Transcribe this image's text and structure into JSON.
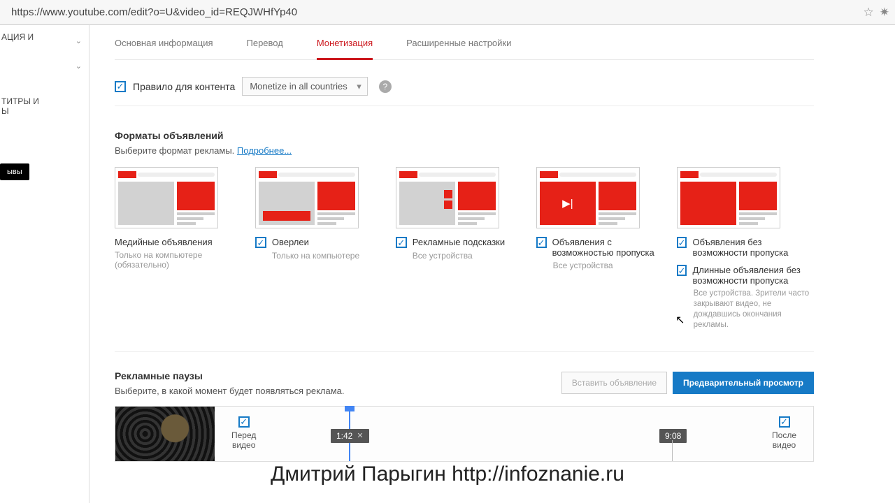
{
  "address_bar": {
    "url": "https://www.youtube.com/edit?o=U&video_id=REQJWHfYp40"
  },
  "sidebar": {
    "sec1": "АЦИЯ И",
    "sec2": "ТИТРЫ И\nЫ",
    "reviews_btn": "ывы"
  },
  "tabs": {
    "basic": "Основная информация",
    "translate": "Перевод",
    "monetize": "Монетизация",
    "advanced": "Расширенные настройки"
  },
  "policy": {
    "checkbox_label": "Правило для контента",
    "dropdown_value": "Monetize in all countries"
  },
  "formats": {
    "heading": "Форматы объявлений",
    "subtext": "Выберите формат рекламы. ",
    "more": "Подробнее...",
    "f1": {
      "title": "Медийные объявления",
      "sub": "Только на компьютере (обязательно)"
    },
    "f2": {
      "title": "Оверлеи",
      "sub": "Только на компьютере"
    },
    "f3": {
      "title": "Рекламные подсказки",
      "sub": "Все устройства"
    },
    "f4": {
      "title": "Объявления с возможностью пропуска",
      "sub": "Все устройства"
    },
    "f5a": {
      "title": "Объявления без возможности пропуска"
    },
    "f5b": {
      "title": "Длинные объявления без возможности пропуска",
      "sub": "Все устройства. Зрители часто закрывают видео, не дождавшись окончания рекламы."
    }
  },
  "pauses": {
    "heading": "Рекламные паузы",
    "sub": "Выберите, в какой момент будет появляться реклама.",
    "insert_btn": "Вставить объявление",
    "preview_btn": "Предварительный просмотр",
    "before": "Перед\nвидео",
    "after": "После\nвидео",
    "t1": "1:42",
    "t2": "9:08"
  },
  "watermark": "Дмитрий Парыгин    http://infoznanie.ru"
}
